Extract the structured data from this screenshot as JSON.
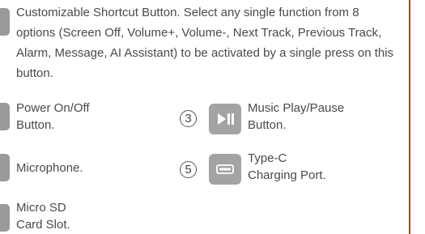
{
  "description": "Customizable Shortcut Button. Select any single function from 8 options (Screen Off, Volume+, Volume-, Next Track, Previous Track, Alarm, Message, AI Assistant) to be activated by a single press on this button.",
  "features": [
    {
      "number": "",
      "label_line1": "Power On/Off",
      "label_line2": "Button.",
      "icon": "power-icon"
    },
    {
      "number": "③",
      "label_line1": "Music Play/Pause",
      "label_line2": "Button.",
      "icon": "play-pause-icon"
    },
    {
      "number": "",
      "label_line1": "Microphone.",
      "label_line2": "",
      "icon": "microphone-icon"
    },
    {
      "number": "⑤",
      "label_line1": "Type-C",
      "label_line2": "Charging Port.",
      "icon": "type-c-port-icon"
    },
    {
      "number": "",
      "label_line1": "Micro SD",
      "label_line2": "Card Slot.",
      "icon": "sd-card-icon"
    }
  ],
  "colors": {
    "text": "#4a4a4a",
    "icon_gray": "#a3a3a3",
    "accent_rule": "#c0392b"
  }
}
